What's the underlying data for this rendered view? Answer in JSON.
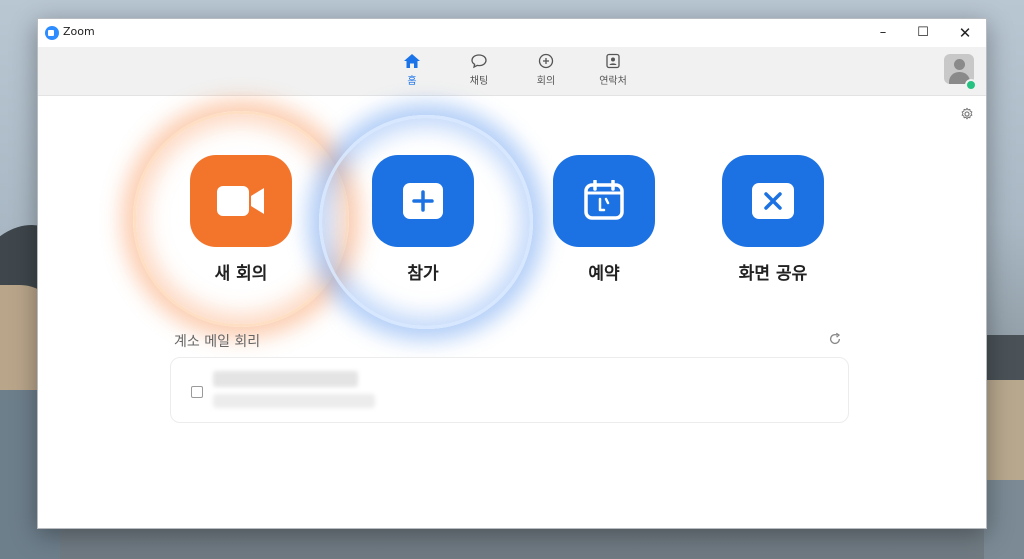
{
  "window": {
    "title": "Zoom"
  },
  "titlebar": {
    "minimize": "–",
    "maximize": "☐",
    "close": "✕"
  },
  "tabs": [
    {
      "label": "홈",
      "icon": "home-icon",
      "active": true
    },
    {
      "label": "채팅",
      "icon": "chat-icon",
      "active": false
    },
    {
      "label": "회의",
      "icon": "meetings-icon",
      "active": false
    },
    {
      "label": "연락처",
      "icon": "contacts-icon",
      "active": false
    }
  ],
  "actions": [
    {
      "label": "새 회의",
      "icon": "video-camera-icon",
      "color": "#f3752b"
    },
    {
      "label": "참가",
      "icon": "plus-icon",
      "color": "#1c72e3"
    },
    {
      "label": "예약",
      "icon": "calendar-icon",
      "color": "#1c72e3"
    },
    {
      "label": "화면 공유",
      "icon": "share-screen-icon",
      "color": "#1c72e3"
    }
  ],
  "meetings": {
    "title": "계소 메일 회리"
  },
  "colors": {
    "accent": "#1a73e8",
    "presence": "#26c281"
  }
}
